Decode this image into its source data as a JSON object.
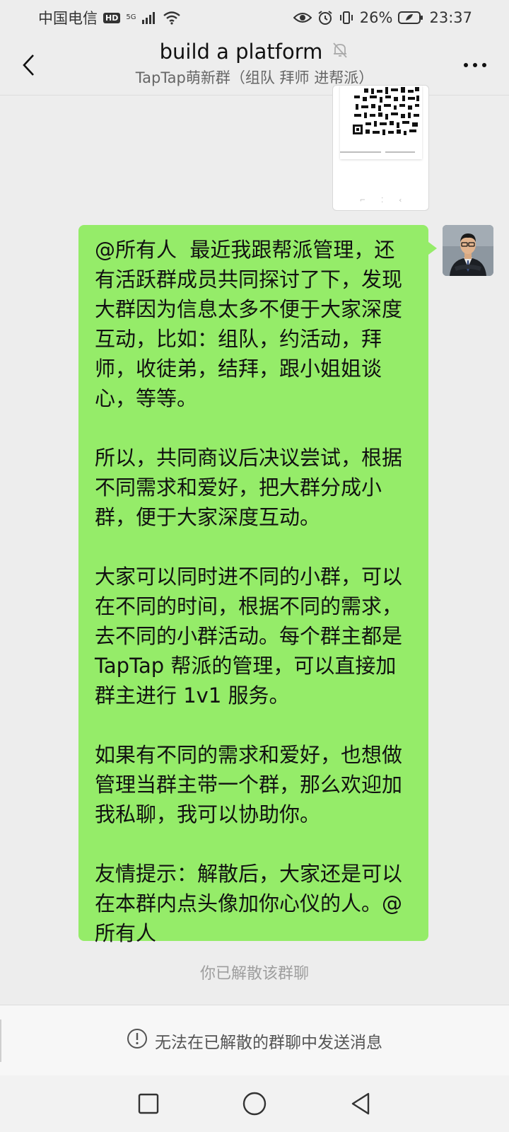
{
  "status_bar": {
    "carrier": "中国电信",
    "hd": "HD",
    "network": "5G",
    "battery": "26%",
    "time": "23:37",
    "icons": [
      "eye-icon",
      "alarm-icon",
      "vibrate-icon",
      "battery-icon",
      "wifi-icon",
      "signal-icon"
    ]
  },
  "header": {
    "title": "build a platform",
    "subtitle": "TapTap萌新群（组队 拜师 进帮派）",
    "icons": [
      "back-icon",
      "mute-bell-icon",
      "more-icon"
    ]
  },
  "message": {
    "text": "@所有人  最近我跟帮派管理，还有活跃群成员共同探讨了下，发现大群因为信息太多不便于大家深度互动，比如：组队，约活动，拜师，收徒弟，结拜，跟小姐姐谈心，等等。\n\n所以，共同商议后决议尝试，根据不同需求和爱好，把大群分成小群，便于大家深度互动。\n\n大家可以同时进不同的小群，可以在不同的时间，根据不同的需求，去不同的小群活动。每个群主都是TapTap 帮派的管理，可以直接加群主进行 1v1 服务。\n\n如果有不同的需求和爱好，也想做管理当群主带一个群，那么欢迎加我私聊，我可以协助你。\n\n友情提示：解散后，大家还是可以在本群内点头像加你心仪的人。@所有人",
    "bubble_color": "#95ec69"
  },
  "system_note": "你已解散该群聊",
  "input_bar": {
    "notice": "无法在已解散的群聊中发送消息",
    "icon": "info-icon"
  },
  "nav_bar": {
    "icons": [
      "recents-square-icon",
      "home-circle-icon",
      "back-triangle-icon"
    ]
  },
  "colors": {
    "background": "#ededed",
    "bubble": "#95ec69"
  }
}
